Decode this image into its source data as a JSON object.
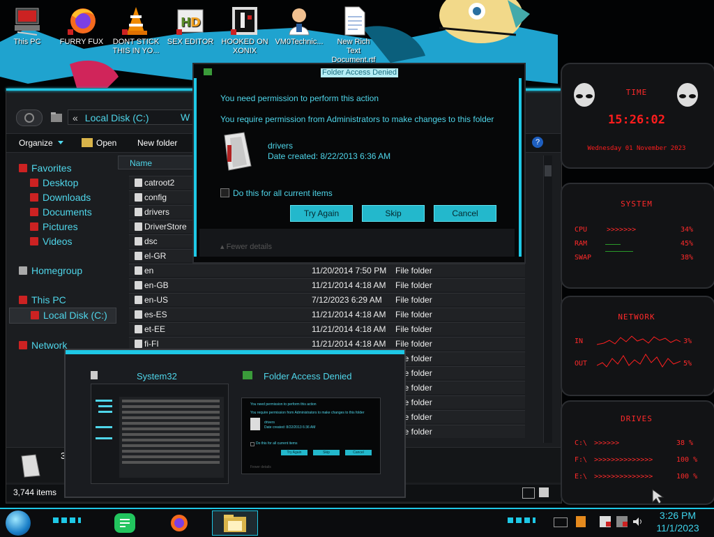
{
  "desktop": {
    "icons": [
      {
        "label": "This PC"
      },
      {
        "label": "FURRY FUX"
      },
      {
        "label": "DONT STICK THIS IN YO..."
      },
      {
        "label": "SEX EDITOR"
      },
      {
        "label": "HOOKED ON XONIX"
      },
      {
        "label": "VM0Technic..."
      },
      {
        "label": "New Rich Text Document.rtf"
      }
    ]
  },
  "explorer": {
    "address": {
      "back_glyph": "«",
      "location": "Local Disk (C:)",
      "next_segment": "W"
    },
    "commands": {
      "organize": "Organize",
      "open": "Open",
      "new_folder": "New folder"
    },
    "column_name": "Name",
    "nav": {
      "favorites": "Favorites",
      "desktop": "Desktop",
      "downloads": "Downloads",
      "documents": "Documents",
      "pictures": "Pictures",
      "videos": "Videos",
      "homegroup": "Homegroup",
      "this_pc": "This PC",
      "local_disk": "Local Disk (C:)",
      "network": "Network"
    },
    "rows": [
      {
        "name": "catroot2",
        "date": "",
        "type": ""
      },
      {
        "name": "config",
        "date": "",
        "type": ""
      },
      {
        "name": "drivers",
        "date": "",
        "type": ""
      },
      {
        "name": "DriverStore",
        "date": "",
        "type": ""
      },
      {
        "name": "dsc",
        "date": "",
        "type": ""
      },
      {
        "name": "el-GR",
        "date": "",
        "type": ""
      },
      {
        "name": "en",
        "date": "11/20/2014 7:50 PM",
        "type": "File folder"
      },
      {
        "name": "en-GB",
        "date": "11/21/2014 4:18 AM",
        "type": "File folder"
      },
      {
        "name": "en-US",
        "date": "7/12/2023 6:29 AM",
        "type": "File folder"
      },
      {
        "name": "es-ES",
        "date": "11/21/2014 4:18 AM",
        "type": "File folder"
      },
      {
        "name": "et-EE",
        "date": "11/21/2014 4:18 AM",
        "type": "File folder"
      },
      {
        "name": "fi-FI",
        "date": "11/21/2014 4:18 AM",
        "type": "File folder"
      },
      {
        "name": "",
        "date": "",
        "type": "File folder"
      },
      {
        "name": "",
        "date": "",
        "type": "File folder"
      },
      {
        "name": "",
        "date": "",
        "type": "File folder"
      },
      {
        "name": "",
        "date": "",
        "type": "File folder"
      },
      {
        "name": "",
        "date": "",
        "type": "File folder"
      },
      {
        "name": "",
        "date": "",
        "type": "File folder"
      }
    ],
    "details_count": "3,",
    "status_items": "3,744 items"
  },
  "dialog": {
    "title": "Folder Access Denied",
    "line1": "You need permission to perform this action",
    "line2": "You require permission from Administrators to make changes to this folder",
    "item_name": "drivers",
    "item_date": "Date created: 8/22/2013 6:36 AM",
    "checkbox_label": "Do this for all current items",
    "try_again": "Try Again",
    "skip": "Skip",
    "cancel": "Cancel",
    "fewer_details": "Fewer details"
  },
  "thumbnails": {
    "left_title": "System32",
    "right_title": "Folder Access Denied",
    "mini_line1": "You need permission to perform this action",
    "mini_line2": "You require permission from Administrators to make changes to this folder",
    "mini_item": "drivers",
    "mini_date": "Date created: 8/22/2013 6:36 AM",
    "mini_checkbox": "Do this for all current items",
    "mini_try": "Try Again",
    "mini_skip": "Skip",
    "mini_cancel": "Cancel",
    "mini_fewer": "Fewer details"
  },
  "gadgets": {
    "time_title": "TIME",
    "time": "15:26:02",
    "date_line": "Wednesday 01 November 2023",
    "system_title": "SYSTEM",
    "cpu_label": "CPU",
    "cpu_value": "34%",
    "ram_label": "RAM",
    "ram_value": "45%",
    "swap_label": "SWAP",
    "swap_value": "38%",
    "network_title": "NETWORK",
    "in_label": "IN",
    "in_value": "3%",
    "out_label": "OUT",
    "out_value": "5%",
    "drives_title": "DRIVES",
    "drive_c_label": "C:\\",
    "drive_c_value": "38 %",
    "drive_f_label": "F:\\",
    "drive_f_value": "100 %",
    "drive_e_label": "E:\\",
    "drive_e_value": "100 %"
  },
  "taskbar": {
    "clock_time": "3:26 PM",
    "clock_date": "11/1/2023"
  },
  "colors": {
    "accent": "#1ec8e6",
    "gadget_red": "#ff1d1d",
    "dialog_text": "#4fd6ea"
  }
}
